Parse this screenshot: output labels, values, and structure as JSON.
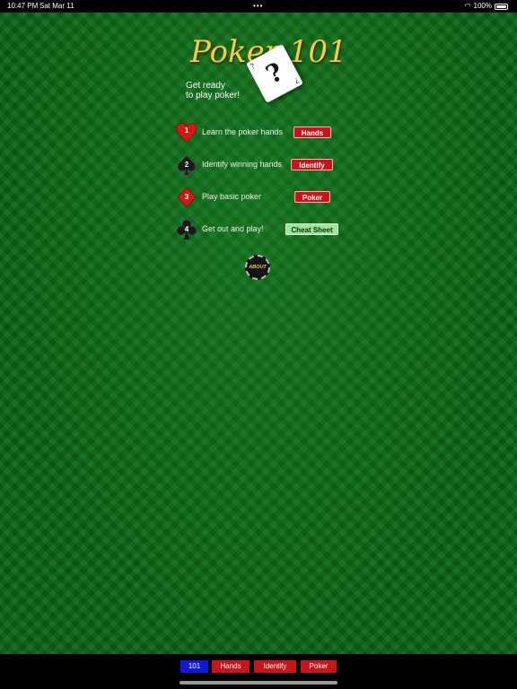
{
  "status_bar": {
    "time": "10:47 PM",
    "date": "Sat Mar 11",
    "battery": "100%",
    "icons": [
      "more-dots-icon",
      "wifi-icon",
      "battery-icon"
    ]
  },
  "header": {
    "logo_text": "Poker 101",
    "tagline_line1": "Get ready",
    "tagline_line2": "to play poker!"
  },
  "steps": [
    {
      "number": "1",
      "suit": "heart",
      "label": "Learn the poker hands",
      "button": "Hands"
    },
    {
      "number": "2",
      "suit": "spade",
      "label": "Identify winning hands",
      "button": "Identify"
    },
    {
      "number": "3",
      "suit": "diamond",
      "label": "Play basic poker",
      "button": "Poker"
    },
    {
      "number": "4",
      "suit": "club",
      "label": "Get out and play!",
      "button": "Cheat Sheet"
    }
  ],
  "about_chip": {
    "label": "ABOUT"
  },
  "tab_bar": {
    "tabs": [
      {
        "label": "101",
        "active": true
      },
      {
        "label": "Hands",
        "active": false
      },
      {
        "label": "Identify",
        "active": false
      },
      {
        "label": "Poker",
        "active": false
      }
    ]
  },
  "colors": {
    "felt": "#0c6616",
    "button_red": "#c8151b",
    "button_green": "#9be79b",
    "tab_active": "#0f17d8",
    "logo_gold": "#f1cf4a"
  }
}
